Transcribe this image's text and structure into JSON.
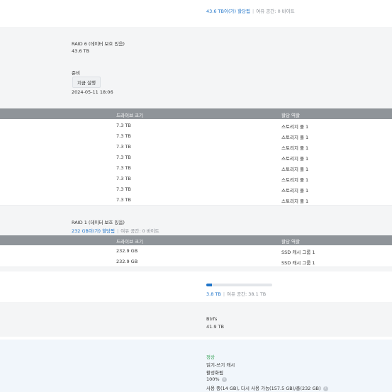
{
  "top": {
    "allocated": "43.6 TB이(가) 할당됨",
    "free": "여유 공간: 0 바이트"
  },
  "raid6": {
    "type": "RAID 6 (데이터 보호 있음)",
    "size": "43.6 TB",
    "scrub_label": "준비",
    "run_button": "지금 실행",
    "last_run": "2024-05-11 18:06"
  },
  "table1": {
    "headers": [
      "드라이브 크기",
      "할당 역할"
    ],
    "rows": [
      [
        "7.3 TB",
        "스토리지 풀 1"
      ],
      [
        "7.3 TB",
        "스토리지 풀 1"
      ],
      [
        "7.3 TB",
        "스토리지 풀 1"
      ],
      [
        "7.3 TB",
        "스토리지 풀 1"
      ],
      [
        "7.3 TB",
        "스토리지 풀 1"
      ],
      [
        "7.3 TB",
        "스토리지 풀 1"
      ],
      [
        "7.3 TB",
        "스토리지 풀 1"
      ],
      [
        "7.3 TB",
        "스토리지 풀 1"
      ]
    ]
  },
  "raid1": {
    "type": "RAID 1 (데이터 보호 있음)",
    "allocated": "232 GB이(가) 할당됨",
    "free": "여유 공간: 0 바이트"
  },
  "table2": {
    "headers": [
      "드라이브 크기",
      "할당 역할"
    ],
    "rows": [
      [
        "232.9 GB",
        "SSD 캐시 그룹 1"
      ],
      [
        "232.9 GB",
        "SSD 캐시 그룹 1"
      ]
    ]
  },
  "volume": {
    "usage_fraction": 0.09,
    "used": "3.8 TB",
    "free": "여유 공간: 38.1 TB"
  },
  "filesystem": {
    "type": "Btrfs",
    "size": "41.9 TB"
  },
  "cache": {
    "status": "정상",
    "mode": "읽기-쓰기 캐시",
    "state": "활성화됨",
    "hit_rate": "100%",
    "usage": "사용 중(14 GB), 다시 사용 가능(157.5 GB)/총(232 GB)",
    "info_icon": "info-icon"
  },
  "colors": {
    "accent": "#1f74c9",
    "header": "#8f9499",
    "status_ok": "#2e9e4f"
  }
}
